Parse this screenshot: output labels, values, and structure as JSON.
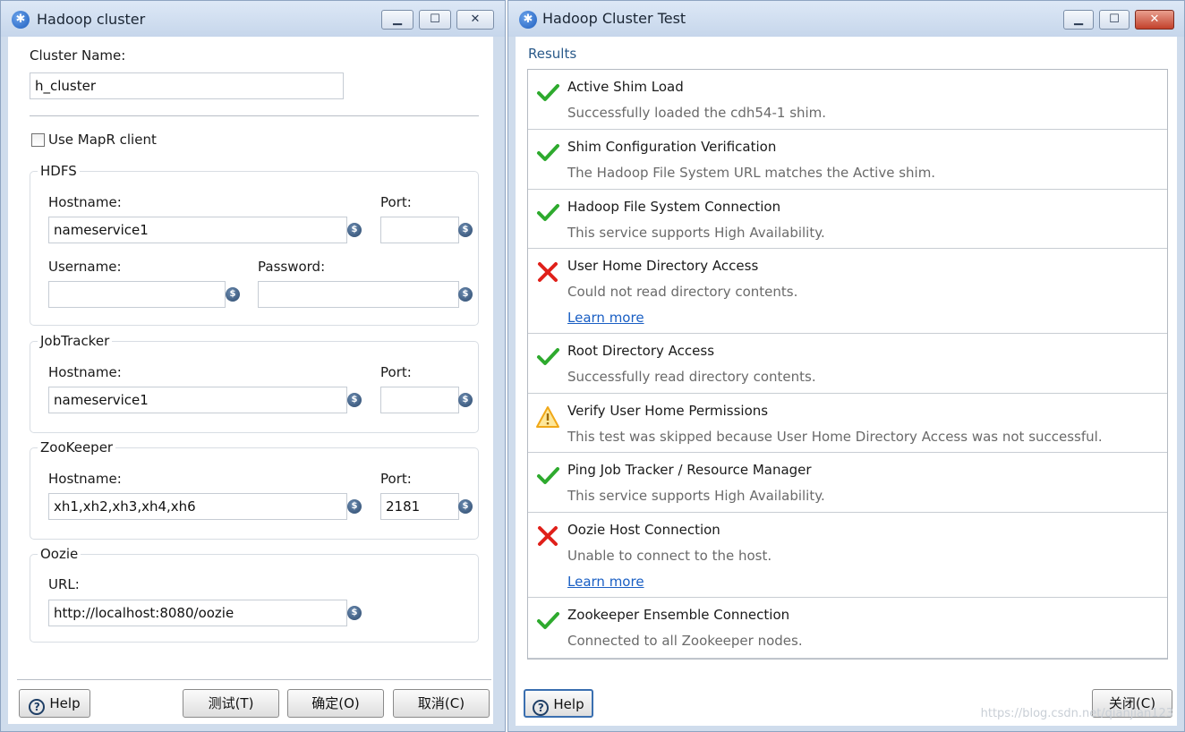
{
  "left_window": {
    "title": "Hadoop cluster",
    "cluster_name_label": "Cluster Name:",
    "cluster_name_value": "h_cluster",
    "mapr_label": "Use MapR client",
    "mapr_checked": false,
    "hdfs": {
      "title": "HDFS",
      "hostname_label": "Hostname:",
      "hostname_value": "nameservice1",
      "port_label": "Port:",
      "port_value": "",
      "username_label": "Username:",
      "username_value": "",
      "password_label": "Password:",
      "password_value": ""
    },
    "jobtracker": {
      "title": "JobTracker",
      "hostname_label": "Hostname:",
      "hostname_value": "nameservice1",
      "port_label": "Port:",
      "port_value": ""
    },
    "zookeeper": {
      "title": "ZooKeeper",
      "hostname_label": "Hostname:",
      "hostname_value": "xh1,xh2,xh3,xh4,xh6",
      "port_label": "Port:",
      "port_value": "2181"
    },
    "oozie": {
      "title": "Oozie",
      "url_label": "URL:",
      "url_value": "http://localhost:8080/oozie"
    },
    "buttons": {
      "help": "Help",
      "test": "测试(T)",
      "ok": "确定(O)",
      "cancel": "取消(C)"
    }
  },
  "right_window": {
    "title": "Hadoop Cluster Test",
    "results_heading": "Results",
    "results": [
      {
        "status": "pass",
        "title": "Active Shim Load",
        "message": "Successfully loaded the cdh54-1 shim.",
        "link": ""
      },
      {
        "status": "pass",
        "title": "Shim Configuration Verification",
        "message": "The Hadoop File System URL matches the Active shim.",
        "link": ""
      },
      {
        "status": "pass",
        "title": "Hadoop File System Connection",
        "message": "This service supports High Availability.",
        "link": ""
      },
      {
        "status": "fail",
        "title": "User Home Directory Access",
        "message": "Could not read directory contents.",
        "link": "Learn more"
      },
      {
        "status": "pass",
        "title": "Root Directory Access",
        "message": "Successfully read directory contents.",
        "link": ""
      },
      {
        "status": "warn",
        "title": "Verify User Home Permissions",
        "message": "This test was skipped because User Home Directory Access was not successful.",
        "link": ""
      },
      {
        "status": "pass",
        "title": "Ping Job Tracker / Resource Manager",
        "message": "This service supports High Availability.",
        "link": ""
      },
      {
        "status": "fail",
        "title": "Oozie Host Connection",
        "message": "Unable to connect to the host.",
        "link": "Learn more"
      },
      {
        "status": "pass",
        "title": "Zookeeper Ensemble Connection",
        "message": "Connected to all Zookeeper nodes.",
        "link": ""
      }
    ],
    "buttons": {
      "help": "Help",
      "close": "关闭(C)"
    }
  },
  "window_controls": {
    "minimize": "▁",
    "maximize": "☐",
    "close": "✕"
  },
  "icons": {
    "app": "hadoop-app-icon",
    "variable": "variable-icon",
    "pass": "check-icon",
    "fail": "cross-icon",
    "warn": "warning-icon"
  },
  "colors": {
    "pass": "#2eaa2e",
    "fail": "#e0201a",
    "warn": "#f0a818",
    "link": "#1a5fc4"
  },
  "watermark": "https://blog.csdn.net/qianjian123"
}
